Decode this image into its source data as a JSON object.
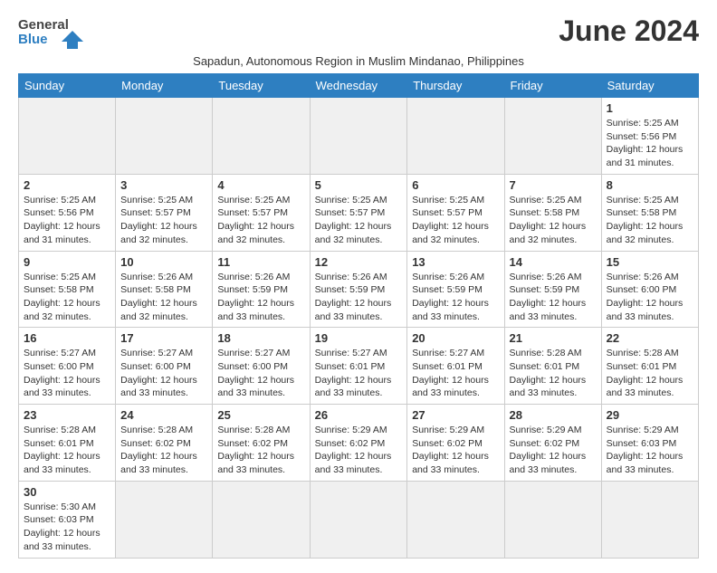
{
  "logo": {
    "text_general": "General",
    "text_blue": "Blue"
  },
  "header": {
    "month_year": "June 2024",
    "subtitle": "Sapadun, Autonomous Region in Muslim Mindanao, Philippines"
  },
  "weekdays": [
    "Sunday",
    "Monday",
    "Tuesday",
    "Wednesday",
    "Thursday",
    "Friday",
    "Saturday"
  ],
  "weeks": [
    [
      {
        "day": "",
        "empty": true
      },
      {
        "day": "",
        "empty": true
      },
      {
        "day": "",
        "empty": true
      },
      {
        "day": "",
        "empty": true
      },
      {
        "day": "",
        "empty": true
      },
      {
        "day": "",
        "empty": true
      },
      {
        "day": "1",
        "sunrise": "5:25 AM",
        "sunset": "5:56 PM",
        "daylight": "12 hours and 31 minutes."
      }
    ],
    [
      {
        "day": "2",
        "sunrise": "5:25 AM",
        "sunset": "5:56 PM",
        "daylight": "12 hours and 31 minutes."
      },
      {
        "day": "3",
        "sunrise": "5:25 AM",
        "sunset": "5:57 PM",
        "daylight": "12 hours and 32 minutes."
      },
      {
        "day": "4",
        "sunrise": "5:25 AM",
        "sunset": "5:57 PM",
        "daylight": "12 hours and 32 minutes."
      },
      {
        "day": "5",
        "sunrise": "5:25 AM",
        "sunset": "5:57 PM",
        "daylight": "12 hours and 32 minutes."
      },
      {
        "day": "6",
        "sunrise": "5:25 AM",
        "sunset": "5:57 PM",
        "daylight": "12 hours and 32 minutes."
      },
      {
        "day": "7",
        "sunrise": "5:25 AM",
        "sunset": "5:58 PM",
        "daylight": "12 hours and 32 minutes."
      },
      {
        "day": "8",
        "sunrise": "5:25 AM",
        "sunset": "5:58 PM",
        "daylight": "12 hours and 32 minutes."
      }
    ],
    [
      {
        "day": "9",
        "sunrise": "5:25 AM",
        "sunset": "5:58 PM",
        "daylight": "12 hours and 32 minutes."
      },
      {
        "day": "10",
        "sunrise": "5:26 AM",
        "sunset": "5:58 PM",
        "daylight": "12 hours and 32 minutes."
      },
      {
        "day": "11",
        "sunrise": "5:26 AM",
        "sunset": "5:59 PM",
        "daylight": "12 hours and 33 minutes."
      },
      {
        "day": "12",
        "sunrise": "5:26 AM",
        "sunset": "5:59 PM",
        "daylight": "12 hours and 33 minutes."
      },
      {
        "day": "13",
        "sunrise": "5:26 AM",
        "sunset": "5:59 PM",
        "daylight": "12 hours and 33 minutes."
      },
      {
        "day": "14",
        "sunrise": "5:26 AM",
        "sunset": "5:59 PM",
        "daylight": "12 hours and 33 minutes."
      },
      {
        "day": "15",
        "sunrise": "5:26 AM",
        "sunset": "6:00 PM",
        "daylight": "12 hours and 33 minutes."
      }
    ],
    [
      {
        "day": "16",
        "sunrise": "5:27 AM",
        "sunset": "6:00 PM",
        "daylight": "12 hours and 33 minutes."
      },
      {
        "day": "17",
        "sunrise": "5:27 AM",
        "sunset": "6:00 PM",
        "daylight": "12 hours and 33 minutes."
      },
      {
        "day": "18",
        "sunrise": "5:27 AM",
        "sunset": "6:00 PM",
        "daylight": "12 hours and 33 minutes."
      },
      {
        "day": "19",
        "sunrise": "5:27 AM",
        "sunset": "6:01 PM",
        "daylight": "12 hours and 33 minutes."
      },
      {
        "day": "20",
        "sunrise": "5:27 AM",
        "sunset": "6:01 PM",
        "daylight": "12 hours and 33 minutes."
      },
      {
        "day": "21",
        "sunrise": "5:28 AM",
        "sunset": "6:01 PM",
        "daylight": "12 hours and 33 minutes."
      },
      {
        "day": "22",
        "sunrise": "5:28 AM",
        "sunset": "6:01 PM",
        "daylight": "12 hours and 33 minutes."
      }
    ],
    [
      {
        "day": "23",
        "sunrise": "5:28 AM",
        "sunset": "6:01 PM",
        "daylight": "12 hours and 33 minutes."
      },
      {
        "day": "24",
        "sunrise": "5:28 AM",
        "sunset": "6:02 PM",
        "daylight": "12 hours and 33 minutes."
      },
      {
        "day": "25",
        "sunrise": "5:28 AM",
        "sunset": "6:02 PM",
        "daylight": "12 hours and 33 minutes."
      },
      {
        "day": "26",
        "sunrise": "5:29 AM",
        "sunset": "6:02 PM",
        "daylight": "12 hours and 33 minutes."
      },
      {
        "day": "27",
        "sunrise": "5:29 AM",
        "sunset": "6:02 PM",
        "daylight": "12 hours and 33 minutes."
      },
      {
        "day": "28",
        "sunrise": "5:29 AM",
        "sunset": "6:02 PM",
        "daylight": "12 hours and 33 minutes."
      },
      {
        "day": "29",
        "sunrise": "5:29 AM",
        "sunset": "6:03 PM",
        "daylight": "12 hours and 33 minutes."
      }
    ],
    [
      {
        "day": "30",
        "sunrise": "5:30 AM",
        "sunset": "6:03 PM",
        "daylight": "12 hours and 33 minutes."
      },
      {
        "day": "",
        "empty": true
      },
      {
        "day": "",
        "empty": true
      },
      {
        "day": "",
        "empty": true
      },
      {
        "day": "",
        "empty": true
      },
      {
        "day": "",
        "empty": true
      },
      {
        "day": "",
        "empty": true
      }
    ]
  ],
  "labels": {
    "sunrise_prefix": "Sunrise: ",
    "sunset_prefix": "Sunset: ",
    "daylight_prefix": "Daylight: "
  }
}
